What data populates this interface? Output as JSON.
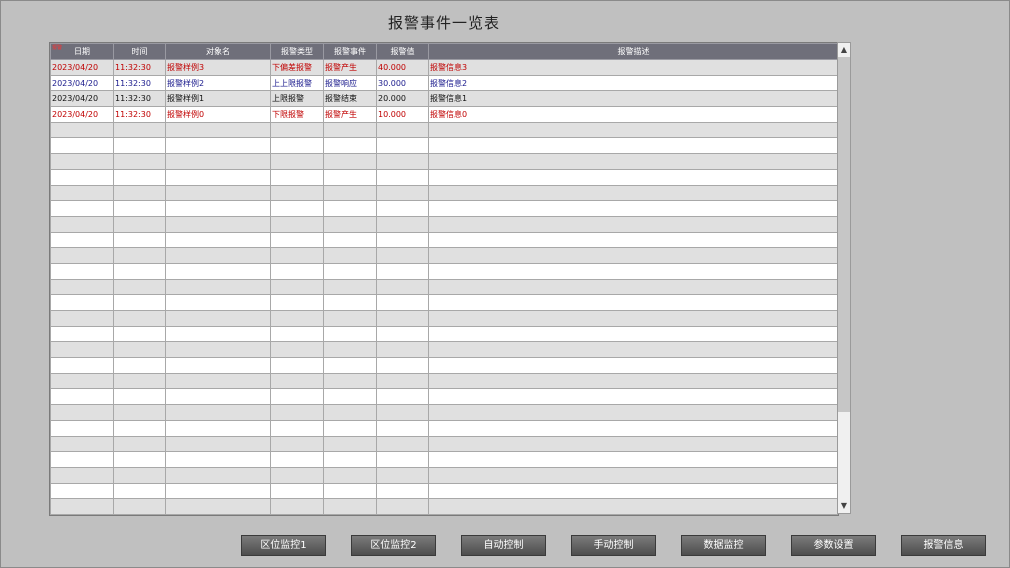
{
  "title": "报警事件一览表",
  "corner_mark": "报警",
  "columns": [
    "日期",
    "时间",
    "对象名",
    "报警类型",
    "报警事件",
    "报警值",
    "报警描述"
  ],
  "rows": [
    {
      "date": "2023/04/20",
      "time": "11:32:30",
      "object": "报警样例3",
      "type": "下偏差报警",
      "event": "报警产生",
      "value": "40.000",
      "desc": "报警信息3",
      "color": "red"
    },
    {
      "date": "2023/04/20",
      "time": "11:32:30",
      "object": "报警样例2",
      "type": "上上限报警",
      "event": "报警响应",
      "value": "30.000",
      "desc": "报警信息2",
      "color": "blue"
    },
    {
      "date": "2023/04/20",
      "time": "11:32:30",
      "object": "报警样例1",
      "type": "上限报警",
      "event": "报警结束",
      "value": "20.000",
      "desc": "报警信息1",
      "color": "black"
    },
    {
      "date": "2023/04/20",
      "time": "11:32:30",
      "object": "报警样例0",
      "type": "下限报警",
      "event": "报警产生",
      "value": "10.000",
      "desc": "报警信息0",
      "color": "red"
    }
  ],
  "colors": {
    "red": "#c00000",
    "blue": "#1a1a8c",
    "black": "#111111"
  },
  "scroll": {
    "up_icon": "▲",
    "down_icon": "▼"
  },
  "buttons": [
    "区位监控1",
    "区位监控2",
    "自动控制",
    "手动控制",
    "数据监控",
    "参数设置",
    "报警信息"
  ]
}
